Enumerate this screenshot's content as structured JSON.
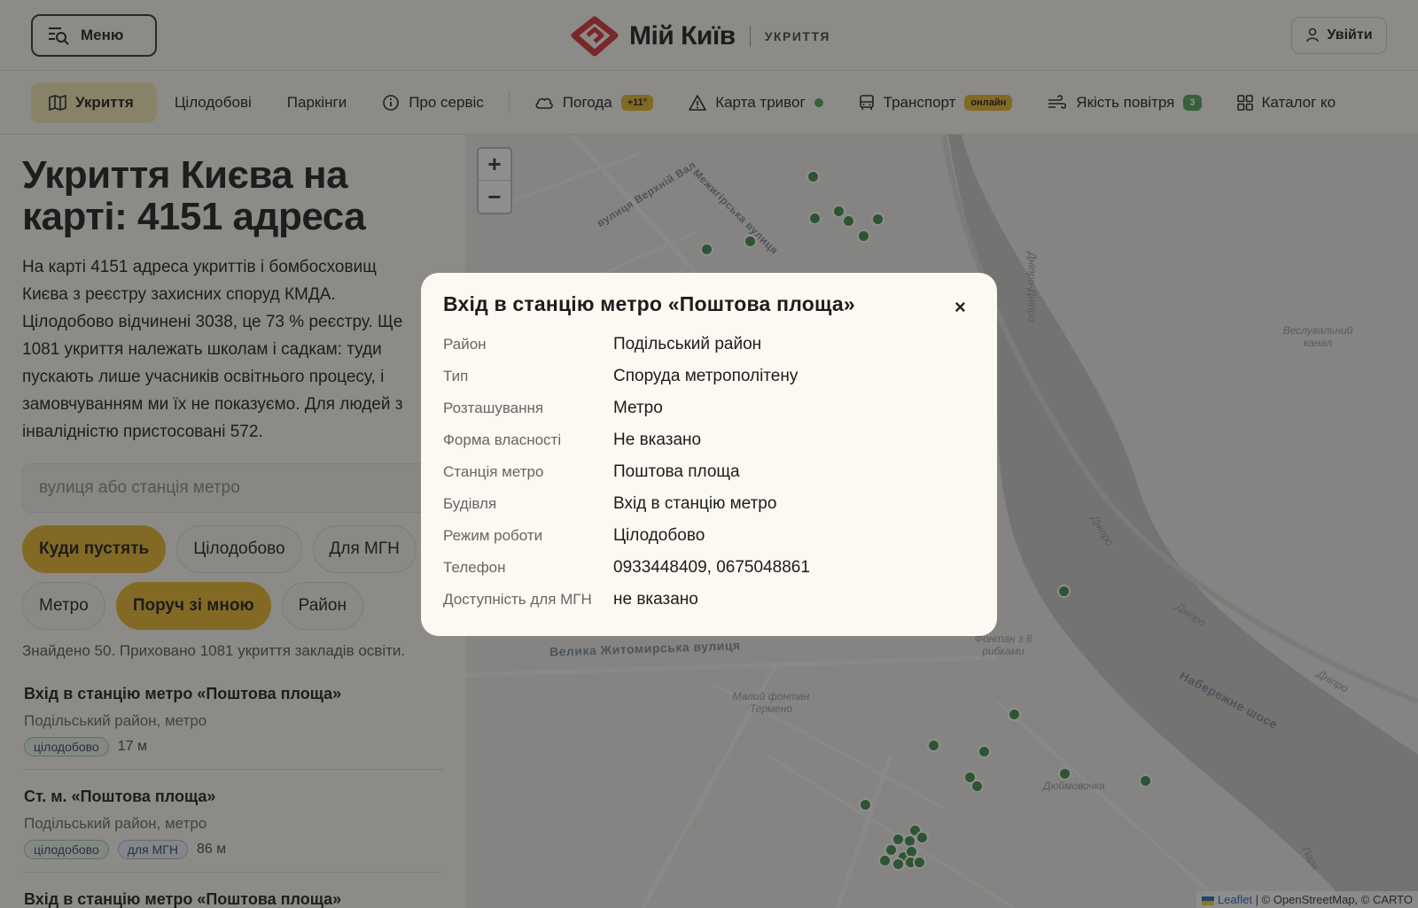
{
  "header": {
    "menu_label": "Меню",
    "logo_title": "Мій Київ",
    "logo_subtitle": "УКРИТТЯ",
    "login_label": "Увійти"
  },
  "nav": {
    "shelters": "Укриття",
    "round_the_clock": "Цілодобові",
    "parkings": "Паркінги",
    "about": "Про сервіс",
    "weather": "Погода",
    "weather_badge": "+11°",
    "alerts": "Карта тривог",
    "transport": "Транспорт",
    "transport_badge": "онлайн",
    "air": "Якість повітря",
    "air_badge": "3",
    "catalog": "Каталог ко"
  },
  "sidebar": {
    "title_line1": "Укриття Києва на",
    "title_line2": "карті: 4151 адреса",
    "intro_lines": [
      "На карті 4151 адреса укриттів і бомбосховищ",
      "Києва з реєстру захисних споруд КМДА.",
      "Цілодобово відчинені 3038, це 73 % реєстру. Ще",
      "1081 укриття належать школам і садкам: туди",
      "пускають лише учасників освітнього процесу, і",
      "замовчуванням ми їх не показуємо. Для людей з",
      "інвалідністю пристосовані 572."
    ],
    "search_placeholder": "вулиця або станція метро",
    "filters": {
      "where": "Куди пустять",
      "round": "Цілодобово",
      "mgn": "Для МГН",
      "metro": "Метро",
      "near": "Поруч зі мною",
      "district": "Район"
    },
    "found_text": "Знайдено 50. Приховано 1081 укриття закладів освіти.",
    "results": [
      {
        "title": "Вхід в станцію метро «Поштова площа»",
        "subtitle": "Подільський район, метро",
        "tag": "цілодобово",
        "distance": "17 м"
      },
      {
        "title": "Ст. м. «Поштова площа»",
        "subtitle": "Подільський район, метро",
        "tag": "цілодобово",
        "tag2": "для МГН",
        "distance": "86 м"
      },
      {
        "title": "Вхід в станцію метро «Поштова площа»"
      }
    ]
  },
  "map": {
    "zoom_in": "+",
    "zoom_out": "−",
    "labels": {
      "verkhnii_val": "вулиця Верхній Вал",
      "mezhyhirska": "Межигірська вулиця",
      "zhytomyrska": "Велика Житомирська вулиця",
      "naberezhne": "Набережне шосе",
      "dnipro1": "Дніпро-Дніпро",
      "dnipro2": "Дніпро",
      "dnipro3": "Дніпро",
      "dnipro4": "Дніпро",
      "vesluvalnyi": "Веслувальний канал",
      "fontan": "Фонтан з 8 рибками",
      "malyi_fontan": "Малий фонтан Термено",
      "diubmovochka": "Дюймовочка",
      "park": "Парк"
    },
    "attribution_leaflet": "Leaflet",
    "attribution_rest": "| © OpenStreetMap, © CARTO"
  },
  "modal": {
    "title": "Вхід в станцію метро «Поштова площа»",
    "close": "×",
    "rows": [
      {
        "key": "Район",
        "value": "Подільський район"
      },
      {
        "key": "Тип",
        "value": "Споруда метрополітену"
      },
      {
        "key": "Розташування",
        "value": "Метро"
      },
      {
        "key": "Форма власності",
        "value": "Не вказано"
      },
      {
        "key": "Станція метро",
        "value": "Поштова площа"
      },
      {
        "key": "Будівля",
        "value": "Вхід в станцію метро"
      },
      {
        "key": "Режим роботи",
        "value": "Цілодобово"
      },
      {
        "key": "Телефон",
        "value": "0933448409, 0675048861"
      },
      {
        "key": "Доступність для МГН",
        "value": "не вказано"
      }
    ]
  },
  "colors": {
    "accent_yellow": "#e8b62b",
    "active_nav": "#f3e9b3",
    "marker_green": "#3d8a48",
    "logo_red": "#d6313a"
  }
}
